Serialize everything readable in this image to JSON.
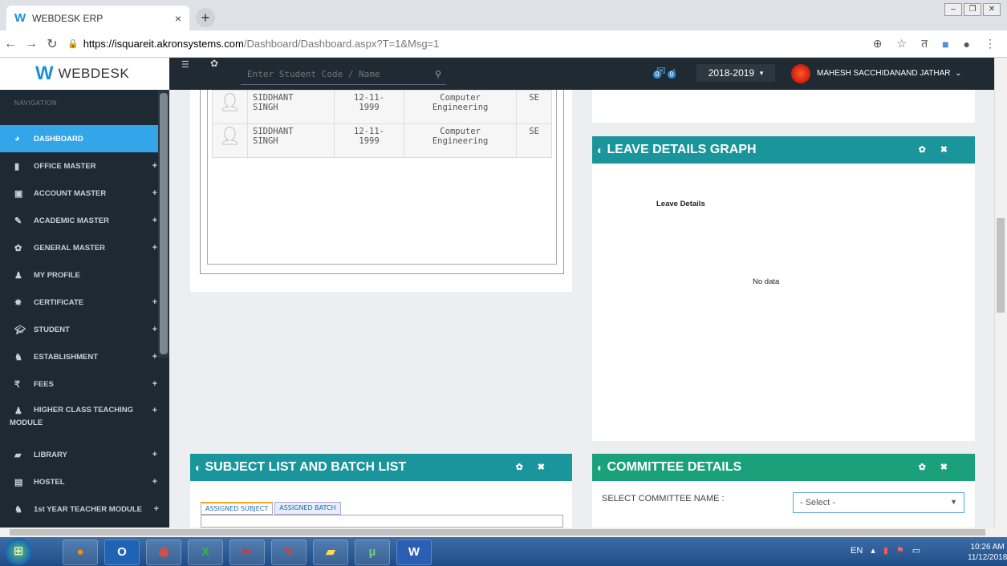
{
  "browser": {
    "tab_title": "WEBDESK ERP",
    "tab_close": "×",
    "new_tab": "+",
    "url_host": "https://isquareit.akronsystems.com",
    "url_path": "/Dashboard/Dashboard.aspx?T=1&Msg=1"
  },
  "header": {
    "logo_text": "WEBDESK",
    "search_placeholder": "Enter Student Code / Name",
    "mail_count": "0",
    "bell_count": "0",
    "year": "2018-2019",
    "year_caret": "▾",
    "user_name": "MAHESH SACCHIDANAND JATHAR",
    "user_caret": "⌄"
  },
  "sidebar": {
    "nav_label": "NAVIGATION",
    "items": [
      {
        "label": "DASHBOARD",
        "icon": "dashboard-icon",
        "plus": ""
      },
      {
        "label": "OFFICE MASTER",
        "icon": "book-icon",
        "plus": "+"
      },
      {
        "label": "ACCOUNT MASTER",
        "icon": "money-icon",
        "plus": "+"
      },
      {
        "label": "ACADEMIC MASTER",
        "icon": "edit-icon",
        "plus": "+"
      },
      {
        "label": "GENERAL MASTER",
        "icon": "gear-icon",
        "plus": "+"
      },
      {
        "label": "MY PROFILE",
        "icon": "user-icon",
        "plus": ""
      },
      {
        "label": "CERTIFICATE",
        "icon": "certificate-icon",
        "plus": "+"
      },
      {
        "label": "STUDENT",
        "icon": "graduation-cap-icon",
        "plus": "+"
      },
      {
        "label": "ESTABLISHMENT",
        "icon": "users-icon",
        "plus": "+"
      },
      {
        "label": "FEES",
        "icon": "rupee-icon",
        "plus": "+"
      },
      {
        "label": "HIGHER CLASS TEACHING",
        "label2": "MODULE",
        "icon": "user-icon",
        "plus": "+"
      },
      {
        "label": "LIBRARY",
        "icon": "book-open-icon",
        "plus": "+"
      },
      {
        "label": "HOSTEL",
        "icon": "building-icon",
        "plus": "+"
      },
      {
        "label": "1st YEAR TEACHER MODULE",
        "icon": "users-icon",
        "plus": "+"
      }
    ]
  },
  "students": [
    {
      "name1": "SIDDHANT",
      "name2": "SINGH",
      "dob1": "12-11-",
      "dob2": "1999",
      "branch1": "Computer",
      "branch2": "Engineering",
      "class": "SE"
    },
    {
      "name1": "SIDDHANT",
      "name2": "SINGH",
      "dob1": "12-11-",
      "dob2": "1999",
      "branch1": "Computer",
      "branch2": "Engineering",
      "class": "SE"
    }
  ],
  "leave_panel": {
    "title": "LEAVE DETAILS GRAPH",
    "chart_title": "Leave Details",
    "empty": "No data"
  },
  "subject_panel": {
    "title": "SUBJECT LIST AND BATCH LIST",
    "tab1": "ASSIGNED SUBJECT",
    "tab2": "ASSIGNED BATCH"
  },
  "committee_panel": {
    "title": "COMMITTEE DETAILS",
    "label": "SELECT COMMITTEE NAME :",
    "select_value": "- Select -"
  },
  "taskbar": {
    "lang": "EN",
    "time": "10:26 AM",
    "date": "11/12/2018"
  },
  "colors": {
    "sidebar_bg": "#1e2a33",
    "active_item": "#33a6e9",
    "panel_teal": "#1a959b",
    "panel_green": "#1aa07a"
  }
}
